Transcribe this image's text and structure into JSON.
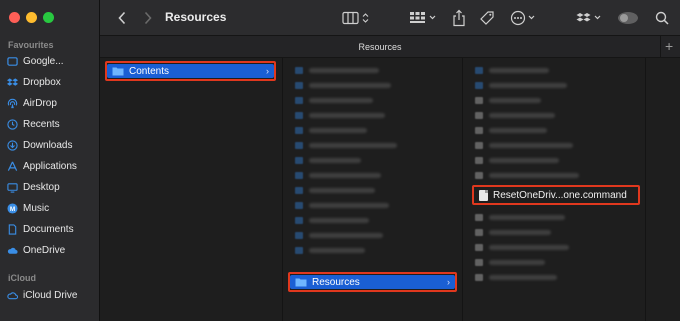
{
  "window": {
    "title": "Resources",
    "tab_label": "Resources"
  },
  "traffic_lights": {
    "close": "#fe5f57",
    "minimize": "#febc2e",
    "zoom": "#28c840"
  },
  "sidebar": {
    "favourites_title": "Favourites",
    "items": [
      {
        "label": "Google...",
        "icon": "google-drive-icon"
      },
      {
        "label": "Dropbox",
        "icon": "dropbox-icon"
      },
      {
        "label": "AirDrop",
        "icon": "airdrop-icon"
      },
      {
        "label": "Recents",
        "icon": "clock-icon"
      },
      {
        "label": "Downloads",
        "icon": "download-icon"
      },
      {
        "label": "Applications",
        "icon": "applications-icon"
      },
      {
        "label": "Desktop",
        "icon": "desktop-icon"
      },
      {
        "label": "Music",
        "icon": "music-icon"
      },
      {
        "label": "Documents",
        "icon": "document-icon"
      },
      {
        "label": "OneDrive",
        "icon": "cloud-icon"
      }
    ],
    "icloud_title": "iCloud",
    "icloud_items": [
      {
        "label": "iCloud Drive",
        "icon": "icloud-icon"
      }
    ]
  },
  "toolbar": {
    "back": "chevron-left-icon",
    "forward": "chevron-right-icon",
    "view": "column-view-icon",
    "group": "group-grid-icon",
    "share": "share-icon",
    "tag": "tag-icon",
    "more": "ellipsis-icon",
    "dropbox": "dropbox-icon",
    "account": "account-icon",
    "search": "search-icon"
  },
  "columns": {
    "col1_selected": "Contents",
    "col2_selected": "Resources",
    "col3_file": "ResetOneDriv...one.command"
  },
  "colors": {
    "selection": "#1a5fd4",
    "highlight_border": "#e0381e",
    "accent": "#3a8ee6"
  }
}
